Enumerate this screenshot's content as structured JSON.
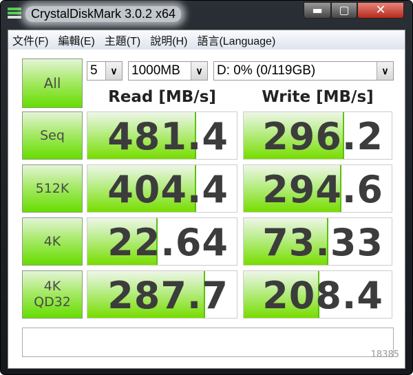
{
  "window": {
    "title": "CrystalDiskMark 3.0.2 x64",
    "minimize": "▬",
    "maximize": "▢",
    "close": "✕"
  },
  "menu": [
    "文件(F)",
    "編輯(E)",
    "主題(T)",
    "說明(H)",
    "語言(Language)"
  ],
  "controls": {
    "all_label": "All",
    "count": "5",
    "size": "1000MB",
    "drive": "D: 0% (0/119GB)",
    "arrow": "∨"
  },
  "headers": {
    "read": "Read [MB/s]",
    "write": "Write [MB/s]"
  },
  "rows": [
    {
      "label": "Seq",
      "read": "481.4",
      "write": "296.2",
      "read_fill": 0.73,
      "write_fill": 0.68
    },
    {
      "label": "512K",
      "read": "404.4",
      "write": "294.6",
      "read_fill": 0.73,
      "write_fill": 0.66
    },
    {
      "label": "4K",
      "read": "22.64",
      "write": "73.33",
      "read_fill": 0.47,
      "write_fill": 0.57
    },
    {
      "label": "4K\nQD32",
      "read": "287.7",
      "write": "208.4",
      "read_fill": 0.79,
      "write_fill": 0.51
    }
  ],
  "comment": "",
  "watermark": "18385"
}
